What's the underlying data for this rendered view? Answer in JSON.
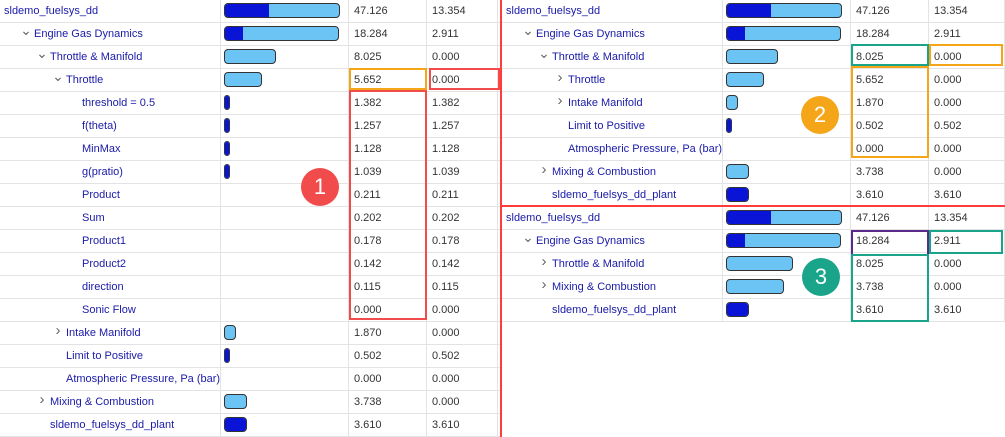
{
  "colors": {
    "red": "#f24b4b",
    "orange": "#f5a518",
    "teal": "#1aa58a",
    "purple": "#5a2a8a",
    "bar_dark": "#0a14d6",
    "bar_light": "#6cc4f5"
  },
  "left_rows": [
    {
      "label": "sldemo_fuelsys_dd",
      "chev": "",
      "depth": 0,
      "bar": {
        "w": 1.0,
        "dark": 0.38
      },
      "v1": "47.126",
      "v2": "13.354"
    },
    {
      "label": "Engine Gas Dynamics",
      "chev": "∨",
      "depth": 1,
      "bar": {
        "w": 0.99,
        "dark": 0.16
      },
      "v1": "18.284",
      "v2": "2.911"
    },
    {
      "label": "Throttle & Manifold",
      "chev": "∨",
      "depth": 2,
      "bar": {
        "w": 0.45,
        "dark": 0
      },
      "v1": "8.025",
      "v2": "0.000"
    },
    {
      "label": "Throttle",
      "chev": "∨",
      "depth": 3,
      "bar": {
        "w": 0.33,
        "dark": 0
      },
      "v1": "5.652",
      "v2": "0.000"
    },
    {
      "label": "threshold = 0.5",
      "chev": "",
      "depth": 4,
      "bar": {
        "w": 0.05,
        "dark": 1
      },
      "v1": "1.382",
      "v2": "1.382"
    },
    {
      "label": "f(theta)",
      "chev": "",
      "depth": 4,
      "bar": {
        "w": 0.05,
        "dark": 1
      },
      "v1": "1.257",
      "v2": "1.257"
    },
    {
      "label": "MinMax",
      "chev": "",
      "depth": 4,
      "bar": {
        "w": 0.05,
        "dark": 1
      },
      "v1": "1.128",
      "v2": "1.128"
    },
    {
      "label": "g(pratio)",
      "chev": "",
      "depth": 4,
      "bar": {
        "w": 0.05,
        "dark": 1
      },
      "v1": "1.039",
      "v2": "1.039"
    },
    {
      "label": "Product",
      "chev": "",
      "depth": 4,
      "bar": null,
      "v1": "0.211",
      "v2": "0.211"
    },
    {
      "label": "Sum",
      "chev": "",
      "depth": 4,
      "bar": null,
      "v1": "0.202",
      "v2": "0.202"
    },
    {
      "label": "Product1",
      "chev": "",
      "depth": 4,
      "bar": null,
      "v1": "0.178",
      "v2": "0.178"
    },
    {
      "label": "Product2",
      "chev": "",
      "depth": 4,
      "bar": null,
      "v1": "0.142",
      "v2": "0.142"
    },
    {
      "label": "direction",
      "chev": "",
      "depth": 4,
      "bar": null,
      "v1": "0.115",
      "v2": "0.115"
    },
    {
      "label": "Sonic Flow",
      "chev": "",
      "depth": 4,
      "bar": null,
      "v1": "0.000",
      "v2": "0.000"
    },
    {
      "label": "Intake Manifold",
      "chev": ">",
      "depth": 3,
      "bar": {
        "w": 0.1,
        "dark": 0
      },
      "v1": "1.870",
      "v2": "0.000"
    },
    {
      "label": "Limit to Positive",
      "chev": "",
      "depth": 3,
      "bar": {
        "w": 0.03,
        "dark": 1
      },
      "v1": "0.502",
      "v2": "0.502"
    },
    {
      "label": "Atmospheric Pressure, Pa (bar)",
      "chev": "",
      "depth": 3,
      "bar": null,
      "v1": "0.000",
      "v2": "0.000"
    },
    {
      "label": "Mixing & Combustion",
      "chev": ">",
      "depth": 2,
      "bar": {
        "w": 0.2,
        "dark": 0
      },
      "v1": "3.738",
      "v2": "0.000"
    },
    {
      "label": "sldemo_fuelsys_dd_plant",
      "chev": "",
      "depth": 2,
      "bar": {
        "w": 0.2,
        "dark": 1
      },
      "v1": "3.610",
      "v2": "3.610"
    }
  ],
  "right_top_rows": [
    {
      "label": "sldemo_fuelsys_dd",
      "chev": "",
      "depth": 0,
      "bar": {
        "w": 1.0,
        "dark": 0.38
      },
      "v1": "47.126",
      "v2": "13.354"
    },
    {
      "label": "Engine Gas Dynamics",
      "chev": "∨",
      "depth": 1,
      "bar": {
        "w": 0.99,
        "dark": 0.16
      },
      "v1": "18.284",
      "v2": "2.911"
    },
    {
      "label": "Throttle & Manifold",
      "chev": "∨",
      "depth": 2,
      "bar": {
        "w": 0.45,
        "dark": 0
      },
      "v1": "8.025",
      "v2": "0.000"
    },
    {
      "label": "Throttle",
      "chev": ">",
      "depth": 3,
      "bar": {
        "w": 0.33,
        "dark": 0
      },
      "v1": "5.652",
      "v2": "0.000"
    },
    {
      "label": "Intake Manifold",
      "chev": ">",
      "depth": 3,
      "bar": {
        "w": 0.1,
        "dark": 0
      },
      "v1": "1.870",
      "v2": "0.000"
    },
    {
      "label": "Limit to Positive",
      "chev": "",
      "depth": 3,
      "bar": {
        "w": 0.03,
        "dark": 1
      },
      "v1": "0.502",
      "v2": "0.502"
    },
    {
      "label": "Atmospheric Pressure, Pa (bar)",
      "chev": "",
      "depth": 3,
      "bar": null,
      "v1": "0.000",
      "v2": "0.000"
    },
    {
      "label": "Mixing & Combustion",
      "chev": ">",
      "depth": 2,
      "bar": {
        "w": 0.2,
        "dark": 0
      },
      "v1": "3.738",
      "v2": "0.000"
    },
    {
      "label": "sldemo_fuelsys_dd_plant",
      "chev": "",
      "depth": 2,
      "bar": {
        "w": 0.2,
        "dark": 1
      },
      "v1": "3.610",
      "v2": "3.610"
    }
  ],
  "right_bottom_rows": [
    {
      "label": "sldemo_fuelsys_dd",
      "chev": "",
      "depth": 0,
      "bar": {
        "w": 1.0,
        "dark": 0.38
      },
      "v1": "47.126",
      "v2": "13.354"
    },
    {
      "label": "Engine Gas Dynamics",
      "chev": "∨",
      "depth": 1,
      "bar": {
        "w": 0.99,
        "dark": 0.16
      },
      "v1": "18.284",
      "v2": "2.911"
    },
    {
      "label": "Throttle & Manifold",
      "chev": ">",
      "depth": 2,
      "bar": {
        "w": 0.58,
        "dark": 0
      },
      "v1": "8.025",
      "v2": "0.000"
    },
    {
      "label": "Mixing & Combustion",
      "chev": ">",
      "depth": 2,
      "bar": {
        "w": 0.5,
        "dark": 0
      },
      "v1": "3.738",
      "v2": "0.000"
    },
    {
      "label": "sldemo_fuelsys_dd_plant",
      "chev": "",
      "depth": 2,
      "bar": {
        "w": 0.2,
        "dark": 1
      },
      "v1": "3.610",
      "v2": "3.610"
    }
  ],
  "badges": [
    "1",
    "2",
    "3"
  ]
}
